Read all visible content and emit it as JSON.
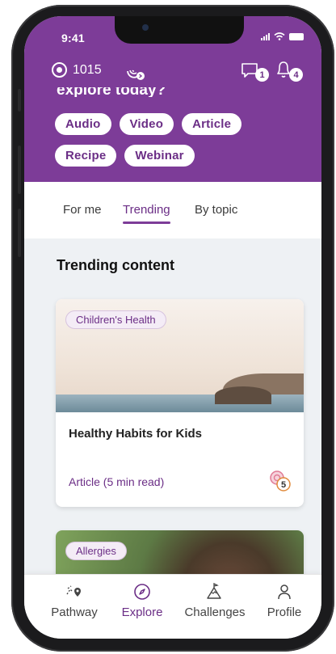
{
  "status_bar": {
    "time": "9:41"
  },
  "header": {
    "points": "1015",
    "streak_icon": "streak-icon",
    "messages_badge": "1",
    "notifications_badge": "4",
    "explore_partial": "explore today?"
  },
  "filters": [
    "Audio",
    "Video",
    "Article",
    "Recipe",
    "Webinar"
  ],
  "tabs": {
    "for_me": "For me",
    "trending": "Trending",
    "by_topic": "By topic",
    "active": "Trending"
  },
  "section_title": "Trending content",
  "cards": [
    {
      "tag": "Children's Health",
      "title": "Healthy Habits for Kids",
      "meta": "Article (5 min read)",
      "reward": "5"
    },
    {
      "tag": "Allergies"
    }
  ],
  "nav": {
    "pathway": "Pathway",
    "explore": "Explore",
    "challenges": "Challenges",
    "profile": "Profile",
    "active": "Explore"
  },
  "colors": {
    "brand": "#7d3c98",
    "accent": "#6b2e86",
    "background": "#eef1f4"
  }
}
